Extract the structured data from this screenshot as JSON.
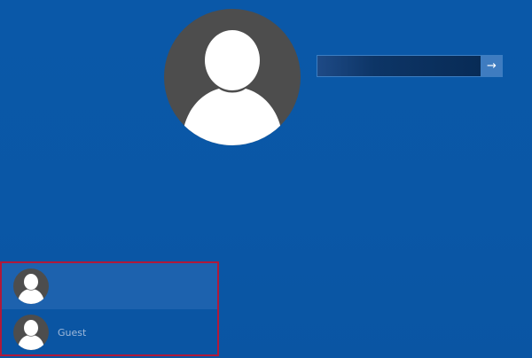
{
  "login": {
    "username_value": "",
    "submit_glyph": "→",
    "submit_icon": "arrow-right-icon"
  },
  "avatar_icon": "user-silhouette-icon",
  "user_list": {
    "items": [
      {
        "name": "",
        "selected": true
      },
      {
        "name": "Guest",
        "selected": false
      }
    ]
  },
  "colors": {
    "background": "#0a58a8",
    "avatar_bg": "#4d4d4d",
    "selection_border": "#b0193a",
    "selected_item": "#1d62ae"
  }
}
